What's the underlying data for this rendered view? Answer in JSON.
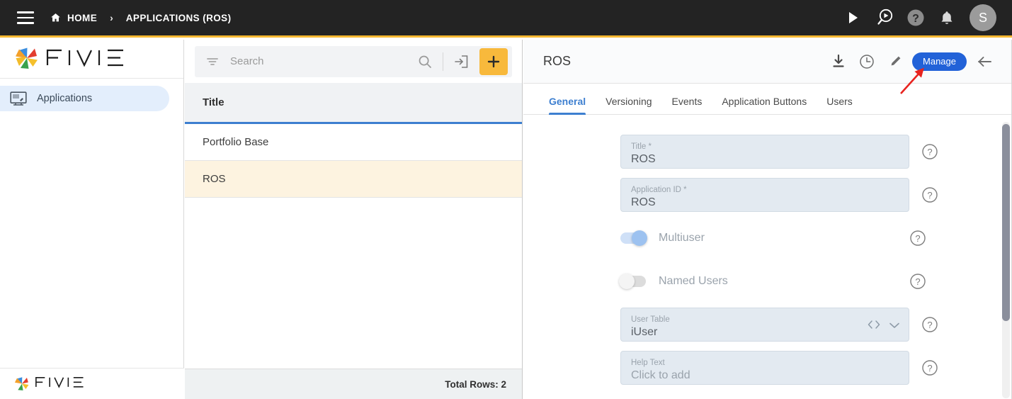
{
  "topbar": {
    "menu_icon": "hamburger-icon",
    "breadcrumb": {
      "home_label": "HOME",
      "separator": "›",
      "current_label": "APPLICATIONS (ROS)"
    },
    "actions": [
      {
        "name": "run-icon",
        "tooltip": "Run"
      },
      {
        "name": "debug-preview-icon",
        "tooltip": "Preview"
      },
      {
        "name": "help-icon",
        "tooltip": "Help"
      },
      {
        "name": "notifications-bell-icon",
        "tooltip": "Notifications"
      }
    ],
    "avatar_initial": "S",
    "accent_bar_color": "#f5b731",
    "background_color": "#232323"
  },
  "sidebar": {
    "brand": "FIVE",
    "items": [
      {
        "label": "Applications",
        "icon": "monitor-icon",
        "active": true
      }
    ],
    "footer_brand": "FIVE",
    "active_background": "#e3eefc"
  },
  "list_panel": {
    "search": {
      "placeholder": "Search",
      "value": "",
      "filter_icon": "filter-icon",
      "search_icon": "search-icon",
      "import_icon": "import-icon",
      "add_icon": "plus-icon",
      "add_button_color": "#f8b93c"
    },
    "column_header": "Title",
    "rows": [
      {
        "title": "Portfolio Base",
        "selected": false
      },
      {
        "title": "ROS",
        "selected": true
      }
    ],
    "selected_row_color": "#fdf3e0",
    "footer": "Total Rows: 2"
  },
  "detail": {
    "title": "ROS",
    "header_actions": [
      {
        "name": "download-icon"
      },
      {
        "name": "history-clock-icon"
      },
      {
        "name": "edit-pencil-icon"
      }
    ],
    "manage_button": {
      "label": "Manage",
      "color": "#2262d8"
    },
    "back_icon": "back-arrow-icon",
    "tabs": [
      {
        "label": "General",
        "active": true
      },
      {
        "label": "Versioning",
        "active": false
      },
      {
        "label": "Events",
        "active": false
      },
      {
        "label": "Application Buttons",
        "active": false
      },
      {
        "label": "Users",
        "active": false
      }
    ],
    "active_tab_color": "#3d7fd0",
    "form": {
      "fields": [
        {
          "type": "text",
          "label": "Title *",
          "value": "ROS",
          "is_placeholder": false,
          "help": "?",
          "icons": []
        },
        {
          "type": "text",
          "label": "Application ID *",
          "value": "ROS",
          "is_placeholder": false,
          "help": "?",
          "icons": []
        },
        {
          "type": "toggle",
          "label": "Multiuser",
          "state": "on",
          "help": "?"
        },
        {
          "type": "toggle",
          "label": "Named Users",
          "state": "off",
          "help": "?"
        },
        {
          "type": "select",
          "label": "User Table",
          "value": "iUser",
          "is_placeholder": false,
          "help": "?",
          "icons": [
            "code-icon",
            "chevron-down-icon"
          ]
        },
        {
          "type": "text",
          "label": "Help Text",
          "value": "Click to add",
          "is_placeholder": true,
          "help": "?",
          "icons": []
        }
      ]
    },
    "scrollbar": {
      "name": "vertical-scrollbar"
    }
  },
  "annotation": {
    "arrow_color": "#e8231f",
    "points_at": "Manage"
  }
}
